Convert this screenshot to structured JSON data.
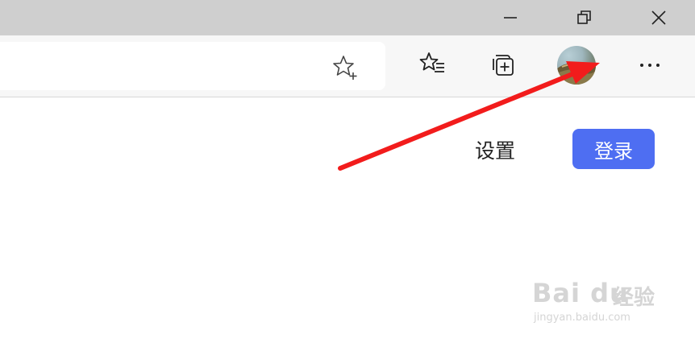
{
  "window_controls": {
    "minimize_icon": "minimize-icon",
    "restore_icon": "restore-icon",
    "close_icon": "close-icon"
  },
  "toolbar": {
    "favorite_icon": "add-favorite-star-icon",
    "favorites_icon": "favorites-list-icon",
    "collections_icon": "collections-icon",
    "profile_icon": "profile-avatar",
    "more_icon": "more-dots-icon"
  },
  "page": {
    "settings_label": "设置",
    "login_label": "登录",
    "login_color": "#4e6ef2"
  },
  "annotation": {
    "arrow_color": "#f21c1c"
  },
  "watermark": {
    "brand": "Bai du",
    "suffix": "经验",
    "url": "jingyan.baidu.com"
  }
}
